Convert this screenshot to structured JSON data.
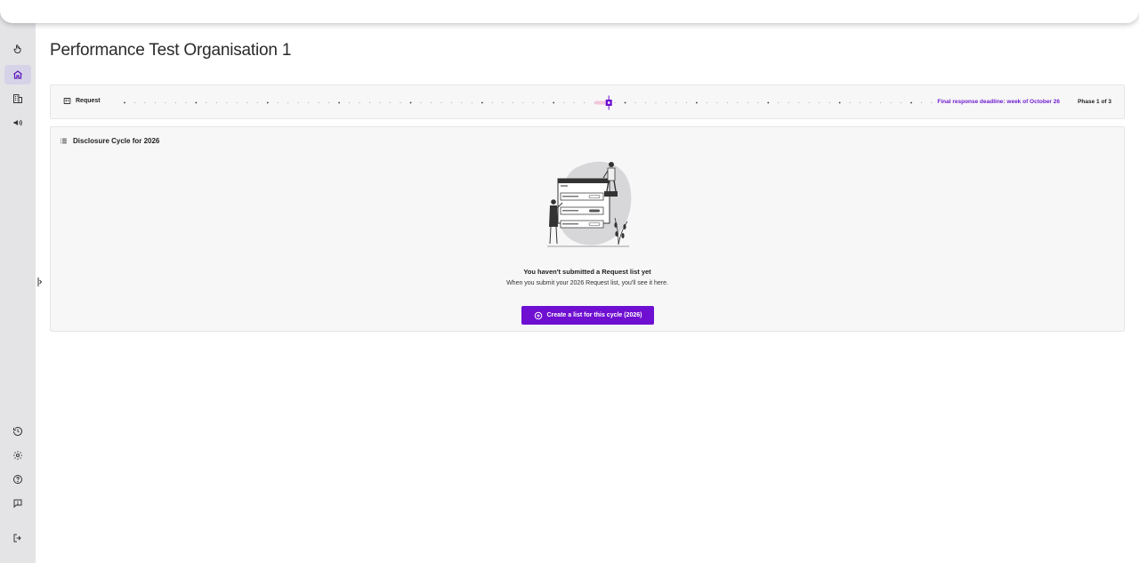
{
  "header": {
    "page_title": "Performance Test Organisation 1"
  },
  "sidebar": {
    "top_items": [
      {
        "icon": "hand-pointer-icon",
        "label": ""
      },
      {
        "icon": "home-icon",
        "label": "",
        "active": true
      },
      {
        "icon": "building-icon",
        "label": ""
      },
      {
        "icon": "megaphone-icon",
        "label": ""
      }
    ],
    "bottom_items": [
      {
        "icon": "history-icon"
      },
      {
        "icon": "gear-icon"
      },
      {
        "icon": "help-icon"
      },
      {
        "icon": "feedback-icon"
      },
      {
        "icon": "logout-icon"
      }
    ]
  },
  "timeline": {
    "label": "Request",
    "deadline": "Final response deadline: week of October 26",
    "phase": "Phase 1 of 3",
    "progress": 0.6
  },
  "cycle": {
    "title": "Disclosure Cycle for 2026",
    "empty_title": "You haven't submitted a Request list yet",
    "empty_subtitle": "When you submit your 2026 Request list, you'll see it here.",
    "create_button_label": "Create a list for this cycle (2026)"
  },
  "colors": {
    "accent": "#6e0fd1",
    "sidebar_bg": "#e4e4e7",
    "card_bg": "#f7f7f8"
  }
}
